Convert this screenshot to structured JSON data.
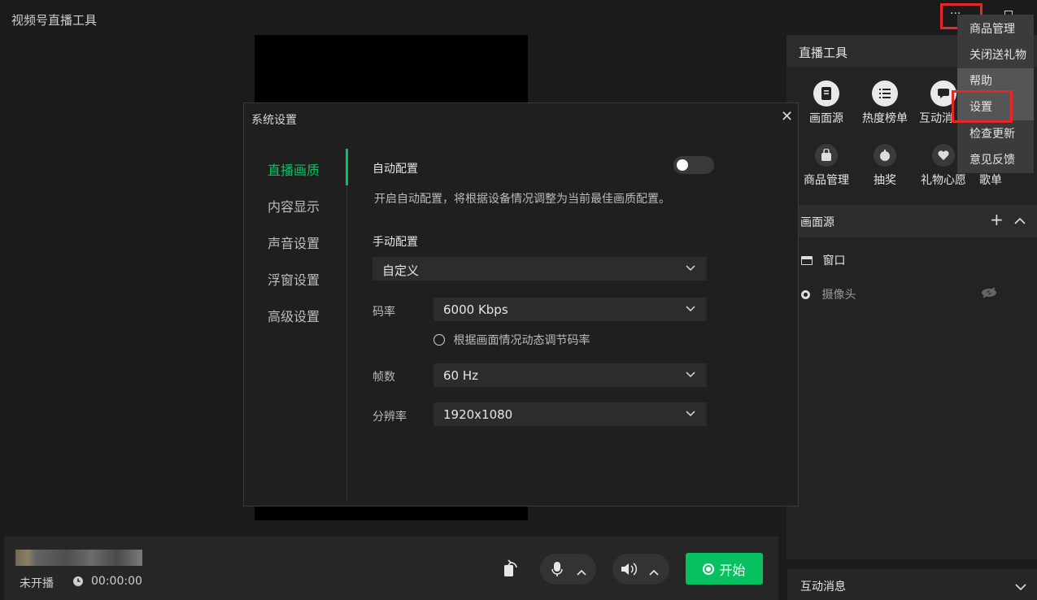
{
  "app": {
    "title": "视频号直播工具"
  },
  "tools_panel": {
    "title": "直播工具",
    "items": [
      {
        "label": "画面源",
        "icon": "screen-source-icon"
      },
      {
        "label": "热度榜单",
        "icon": "list-icon"
      },
      {
        "label": "互动消",
        "icon": "message-icon"
      },
      {
        "label": "商品管理",
        "icon": "bag-icon"
      },
      {
        "label": "抽奖",
        "icon": "lottery-icon"
      },
      {
        "label": "礼物心愿",
        "icon": "gift-heart-icon"
      },
      {
        "label": "歌单",
        "icon": ""
      }
    ]
  },
  "sources": {
    "title": "画面源",
    "items": [
      {
        "label": "窗口",
        "icon": "window-icon"
      },
      {
        "label": "摄像头",
        "icon": "camera-icon"
      }
    ]
  },
  "messages": {
    "title": "互动消息"
  },
  "menu": {
    "items": [
      "商品管理",
      "关闭送礼物",
      "帮助",
      "设置",
      "检查更新",
      "意见反馈"
    ],
    "hovered": "设置",
    "highlight_color": "#e8262a"
  },
  "bottom_bar": {
    "status": "未开播",
    "timer": "00:00:00",
    "start_label": "开始",
    "accent": "#07c160"
  },
  "dialog": {
    "title": "系统设置",
    "nav": [
      "直播画质",
      "内容显示",
      "声音设置",
      "浮窗设置",
      "高级设置"
    ],
    "active_nav": "直播画质",
    "auto_config": {
      "label": "自动配置",
      "enabled": false,
      "hint": "开启自动配置，将根据设备情况调整为当前最佳画质配置。"
    },
    "manual": {
      "label": "手动配置",
      "preset": "自定义",
      "bitrate_label": "码率",
      "bitrate": "6000 Kbps",
      "dynamic_bitrate": "根据画面情况动态调节码率",
      "fps_label": "帧数",
      "fps": "60 Hz",
      "resolution_label": "分辨率",
      "resolution": "1920x1080"
    }
  }
}
